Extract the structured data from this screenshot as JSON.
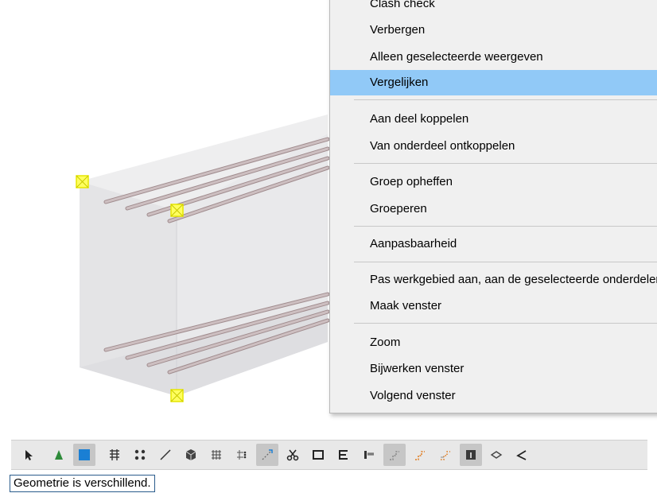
{
  "context_menu": {
    "items": [
      {
        "label": "Clash check",
        "active": false
      },
      {
        "label": "Verbergen",
        "active": false
      },
      {
        "label": "Alleen geselecteerde weergeven",
        "active": false
      },
      {
        "label": "Vergelijken",
        "active": true
      },
      {
        "label": "Aan deel koppelen",
        "active": false
      },
      {
        "label": "Van onderdeel ontkoppelen",
        "active": false
      },
      {
        "label": "Groep opheffen",
        "active": false
      },
      {
        "label": "Groeperen",
        "active": false
      },
      {
        "label": "Aanpasbaarheid",
        "active": false
      },
      {
        "label": "Pas werkgebied aan, aan de geselecteerde onderdelen",
        "active": false
      },
      {
        "label": "Maak venster",
        "active": false
      },
      {
        "label": "Zoom",
        "active": false
      },
      {
        "label": "Bijwerken venster",
        "active": false
      },
      {
        "label": "Volgend venster",
        "active": false
      }
    ]
  },
  "toolbar": {
    "buttons": [
      {
        "icon": "pointer-icon",
        "pressed": false
      },
      {
        "icon": "green-triangle-icon",
        "pressed": false
      },
      {
        "icon": "blue-square-icon",
        "pressed": true
      },
      {
        "icon": "rebar-group-icon",
        "pressed": false
      },
      {
        "icon": "grid-points-icon",
        "pressed": false
      },
      {
        "icon": "line-icon",
        "pressed": false
      },
      {
        "icon": "part-cube-icon",
        "pressed": false
      },
      {
        "icon": "mesh-icon",
        "pressed": false
      },
      {
        "icon": "mesh-points-icon",
        "pressed": false
      },
      {
        "icon": "snap-icon",
        "pressed": true
      },
      {
        "icon": "scissors-icon",
        "pressed": false
      },
      {
        "icon": "rectangle-icon",
        "pressed": false
      },
      {
        "icon": "bracket-icon",
        "pressed": false
      },
      {
        "icon": "comb-icon",
        "pressed": false
      },
      {
        "icon": "step-gray-icon",
        "pressed": true
      },
      {
        "icon": "step-orange-icon",
        "pressed": false
      },
      {
        "icon": "step-orange-alt-icon",
        "pressed": false
      },
      {
        "icon": "panel-icon",
        "pressed": true
      },
      {
        "icon": "layers-icon",
        "pressed": false
      },
      {
        "icon": "angle-icon",
        "pressed": false
      }
    ]
  },
  "status": {
    "message": "Geometrie is verschillend."
  },
  "colors": {
    "menu_highlight": "#91c9f7",
    "handle": "#ffff00",
    "rebar": "#c4b4b6",
    "beam_face": "#e6e6e8"
  }
}
